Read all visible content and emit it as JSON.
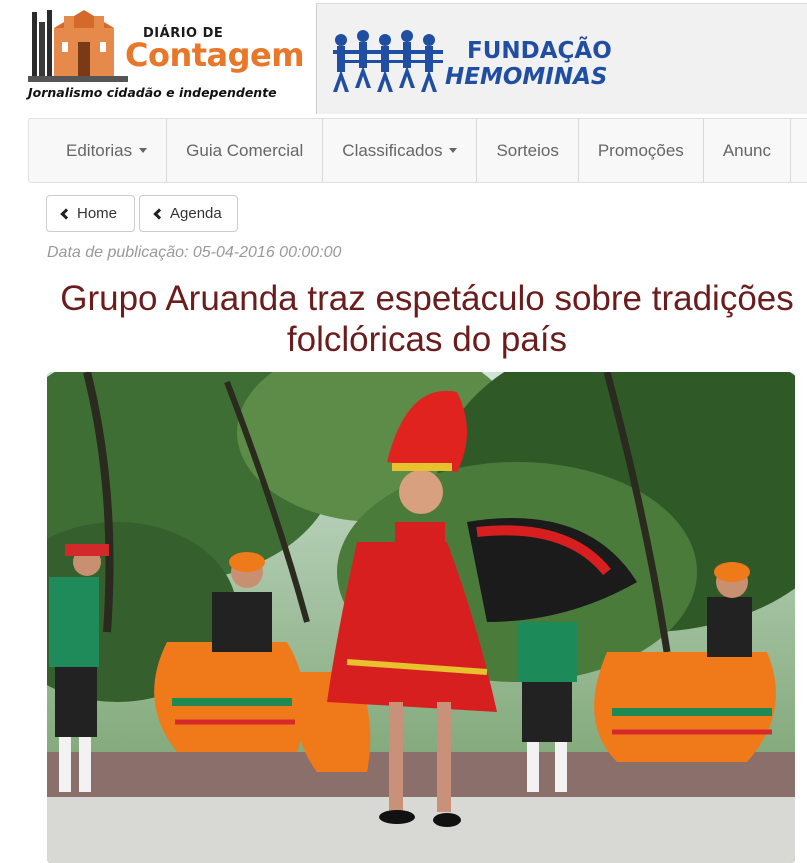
{
  "header": {
    "logo": {
      "small_text": "DIÁRIO DE",
      "big_text": "Contagem",
      "tagline": "Jornalismo cidadão e independente"
    },
    "banner": {
      "line1": "FUNDAÇÃO",
      "line2": "HEMOMINAS"
    }
  },
  "nav": {
    "items": [
      {
        "label": "Editorias",
        "dropdown": true
      },
      {
        "label": "Guia Comercial",
        "dropdown": false
      },
      {
        "label": "Classificados",
        "dropdown": true
      },
      {
        "label": "Sorteios",
        "dropdown": false
      },
      {
        "label": "Promoções",
        "dropdown": false
      },
      {
        "label": "Anunc",
        "dropdown": false
      }
    ]
  },
  "breadcrumb": {
    "home_label": "Home",
    "agenda_label": "Agenda"
  },
  "article": {
    "pubdate": "Data de publicação: 05-04-2016 00:00:00",
    "title": "Grupo Aruanda traz espetáculo sobre tradições folclóricas do país"
  },
  "colors": {
    "accent_orange": "#e8772a",
    "title_red": "#6b1c1c",
    "brand_blue": "#1f4ea3"
  }
}
